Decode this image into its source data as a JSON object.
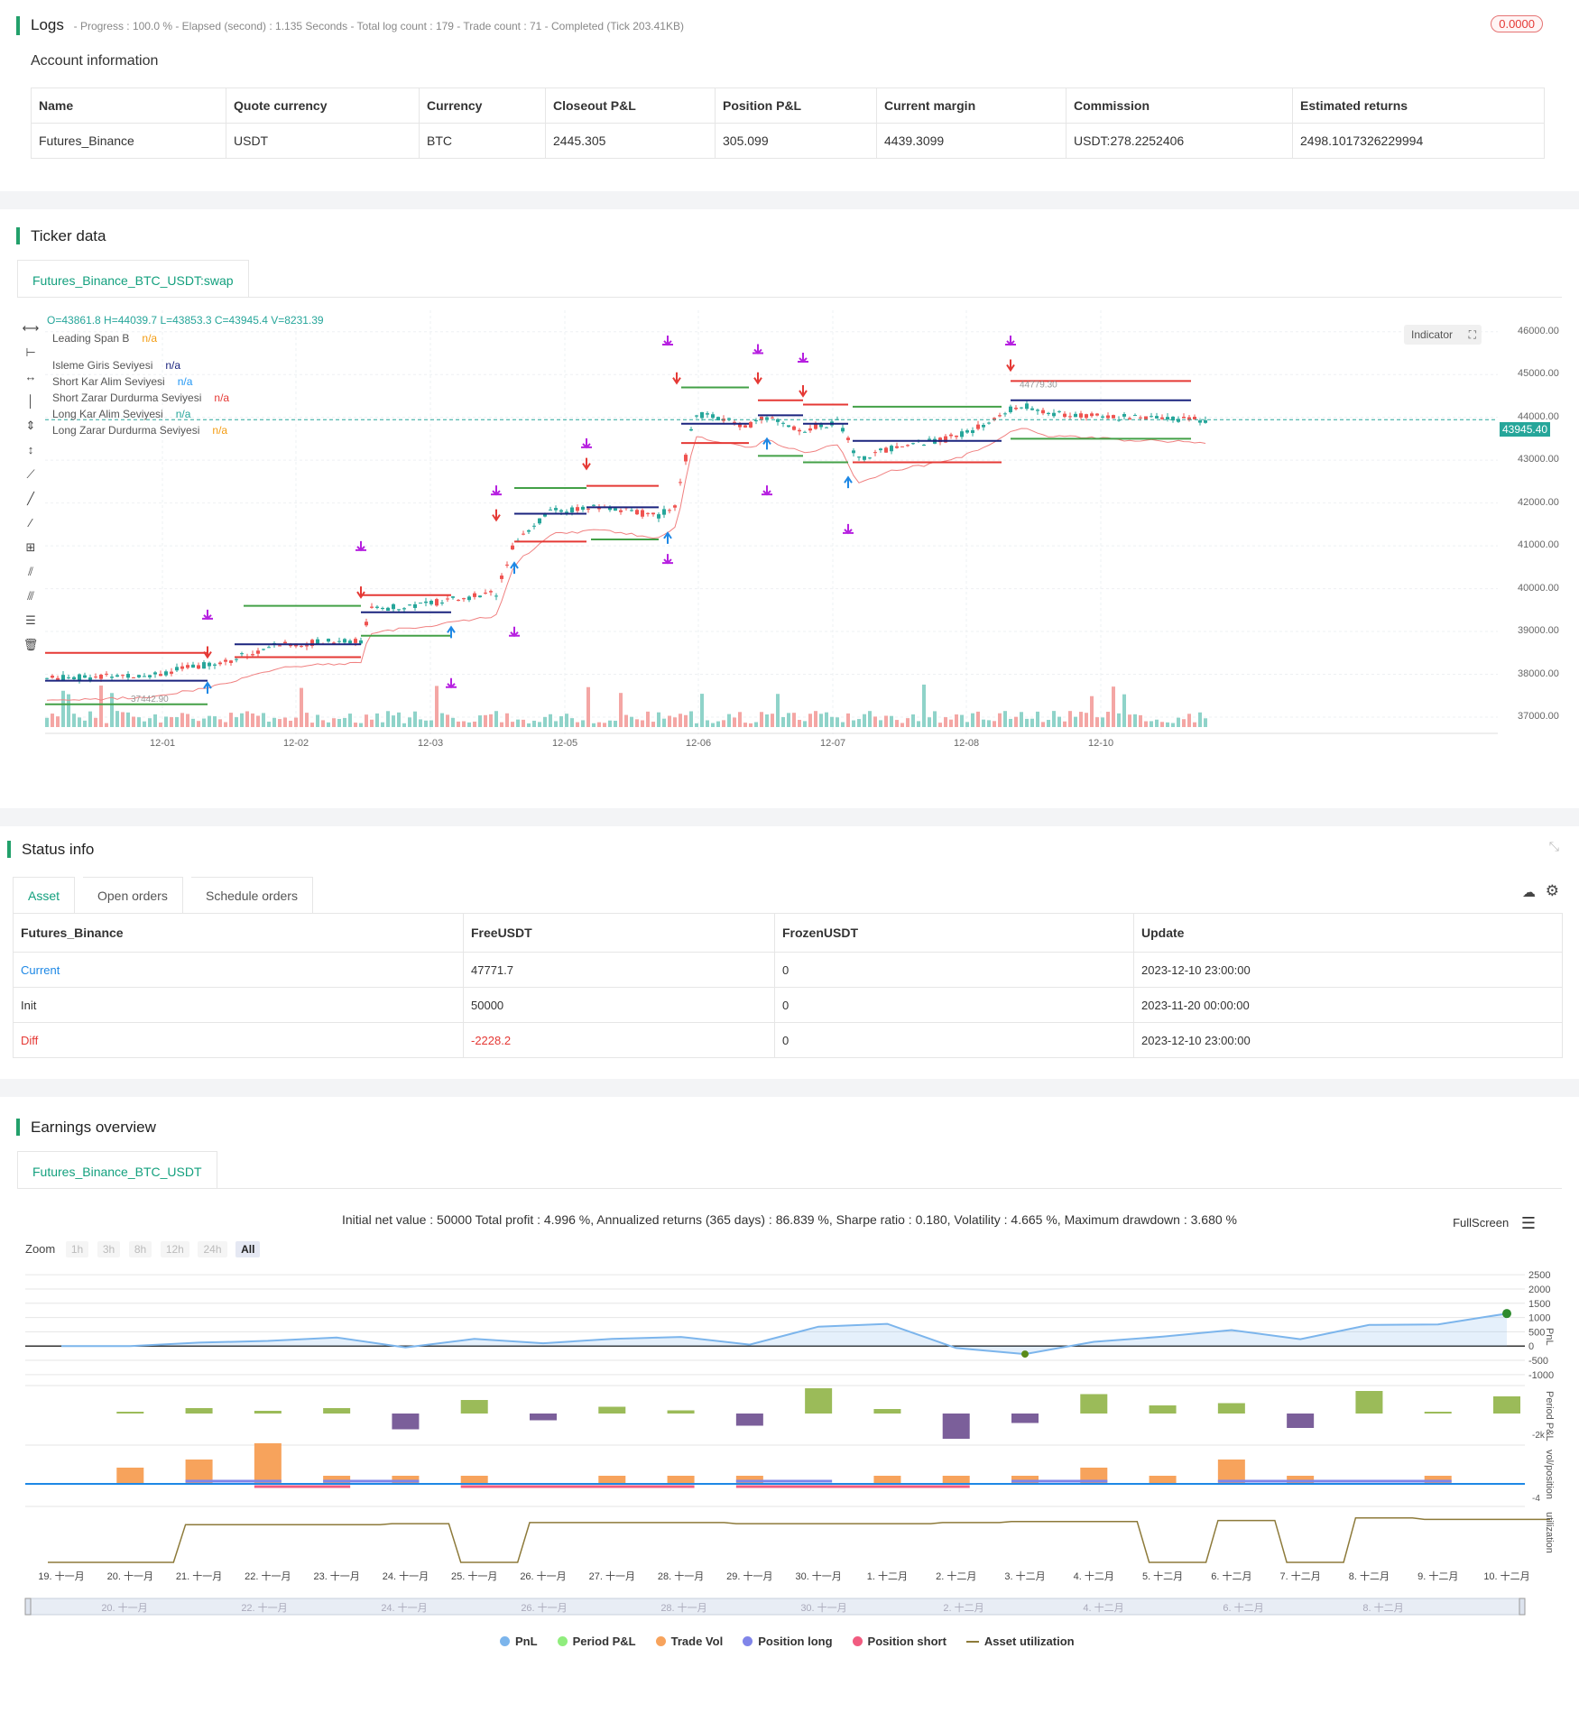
{
  "logs": {
    "title": "Logs",
    "summary": "- Progress : 100.0 % - Elapsed (second) : 1.135  Seconds - Total log count : 179 - Trade count : 71 - Completed (Tick 203.41KB)",
    "badge": "0.0000"
  },
  "account": {
    "title": "Account information",
    "headers": [
      "Name",
      "Quote currency",
      "Currency",
      "Closeout P&L",
      "Position P&L",
      "Current margin",
      "Commission",
      "Estimated returns"
    ],
    "row": [
      "Futures_Binance",
      "USDT",
      "BTC",
      "2445.305",
      "305.099",
      "4439.3099",
      "USDT:278.2252406",
      "2498.1017326229994"
    ]
  },
  "ticker": {
    "title": "Ticker data",
    "tab": "Futures_Binance_BTC_USDT:swap",
    "ohlc": "O=43861.8 H=44039.7 L=43853.3 C=43945.4 V=8231.39",
    "indicator_button": "Indicator",
    "legend": [
      {
        "name": "Leading Span B",
        "value": "n/a",
        "color": "#f39c12"
      },
      {
        "name": "Isleme Giris Seviyesi",
        "value": "n/a",
        "color": "#1a237e"
      },
      {
        "name": "Short Kar Alim Seviyesi",
        "value": "n/a",
        "color": "#2196f3"
      },
      {
        "name": "Short Zarar Durdurma Seviyesi",
        "value": "n/a",
        "color": "#e53935"
      },
      {
        "name": "Long Kar Alim Seviyesi",
        "value": "n/a",
        "color": "#26a69a"
      },
      {
        "name": "Long Zarar Durdurma Seviyesi",
        "value": "n/a",
        "color": "#f39c12"
      }
    ],
    "price_ticks": [
      "46000.00",
      "45000.00",
      "44000.00",
      "43000.00",
      "42000.00",
      "41000.00",
      "40000.00",
      "39000.00",
      "38000.00",
      "37000.00"
    ],
    "date_ticks": [
      "12-01",
      "12-02",
      "12-03",
      "12-05",
      "12-06",
      "12-07",
      "12-08",
      "12-10"
    ],
    "last_price": "43945.40",
    "high_label": "44779.30",
    "low_label": "37442.90"
  },
  "status": {
    "title": "Status info",
    "tabs": [
      "Asset",
      "Open orders",
      "Schedule orders"
    ],
    "headers": [
      "Futures_Binance",
      "FreeUSDT",
      "FrozenUSDT",
      "Update"
    ],
    "rows": [
      {
        "label": "Current",
        "free": "47771.7",
        "frozen": "0",
        "update": "2023-12-10 23:00:00"
      },
      {
        "label": "Init",
        "free": "50000",
        "frozen": "0",
        "update": "2023-11-20 00:00:00"
      },
      {
        "label": "Diff",
        "free": "-2228.2",
        "frozen": "0",
        "update": "2023-12-10 23:00:00"
      }
    ]
  },
  "earnings": {
    "title": "Earnings overview",
    "tab": "Futures_Binance_BTC_USDT",
    "summary": "Initial net value : 50000 Total profit : 4.996 %, Annualized returns (365 days) : 86.839 %, Sharpe ratio : 0.180, Volatility : 4.665 %, Maximum drawdown : 3.680 %",
    "fullscreen": "FullScreen",
    "zoom_label": "Zoom",
    "zoom_buttons": [
      "1h",
      "3h",
      "8h",
      "12h",
      "24h",
      "All"
    ],
    "pnl_ticks": [
      "2500",
      "2000",
      "1500",
      "1000",
      "500",
      "0",
      "-500",
      "-1000"
    ],
    "axis_labels": [
      "PnL",
      "Period P&L",
      "vol/position",
      "utilization"
    ],
    "period_min": "-2k",
    "vol_min": "-4",
    "x_ticks": [
      "19. 十一月",
      "20. 十一月",
      "21. 十一月",
      "22. 十一月",
      "23. 十一月",
      "24. 十一月",
      "25. 十一月",
      "26. 十一月",
      "27. 十一月",
      "28. 十一月",
      "29. 十一月",
      "30. 十一月",
      "1. 十二月",
      "2. 十二月",
      "3. 十二月",
      "4. 十二月",
      "5. 十二月",
      "6. 十二月",
      "7. 十二月",
      "8. 十二月",
      "9. 十二月",
      "10. 十二月"
    ],
    "navigator_ticks": [
      "20. 十一月",
      "22. 十一月",
      "24. 十一月",
      "26. 十一月",
      "28. 十一月",
      "30. 十一月",
      "2. 十二月",
      "4. 十二月",
      "6. 十二月",
      "8. 十二月"
    ],
    "legend": [
      {
        "name": "PnL",
        "color": "#7cb5ec"
      },
      {
        "name": "Period P&L",
        "color": "#90ed7d"
      },
      {
        "name": "Trade Vol",
        "color": "#f7a35c"
      },
      {
        "name": "Position long",
        "color": "#8085e9"
      },
      {
        "name": "Position short",
        "color": "#f15c80"
      },
      {
        "name": "Asset utilization",
        "color": "#8d7a3a"
      }
    ],
    "pnl_series": [
      0,
      0,
      120,
      180,
      300,
      -50,
      250,
      100,
      250,
      320,
      50,
      680,
      780,
      -70,
      -280,
      150,
      330,
      560,
      240,
      740,
      760,
      1140
    ]
  }
}
